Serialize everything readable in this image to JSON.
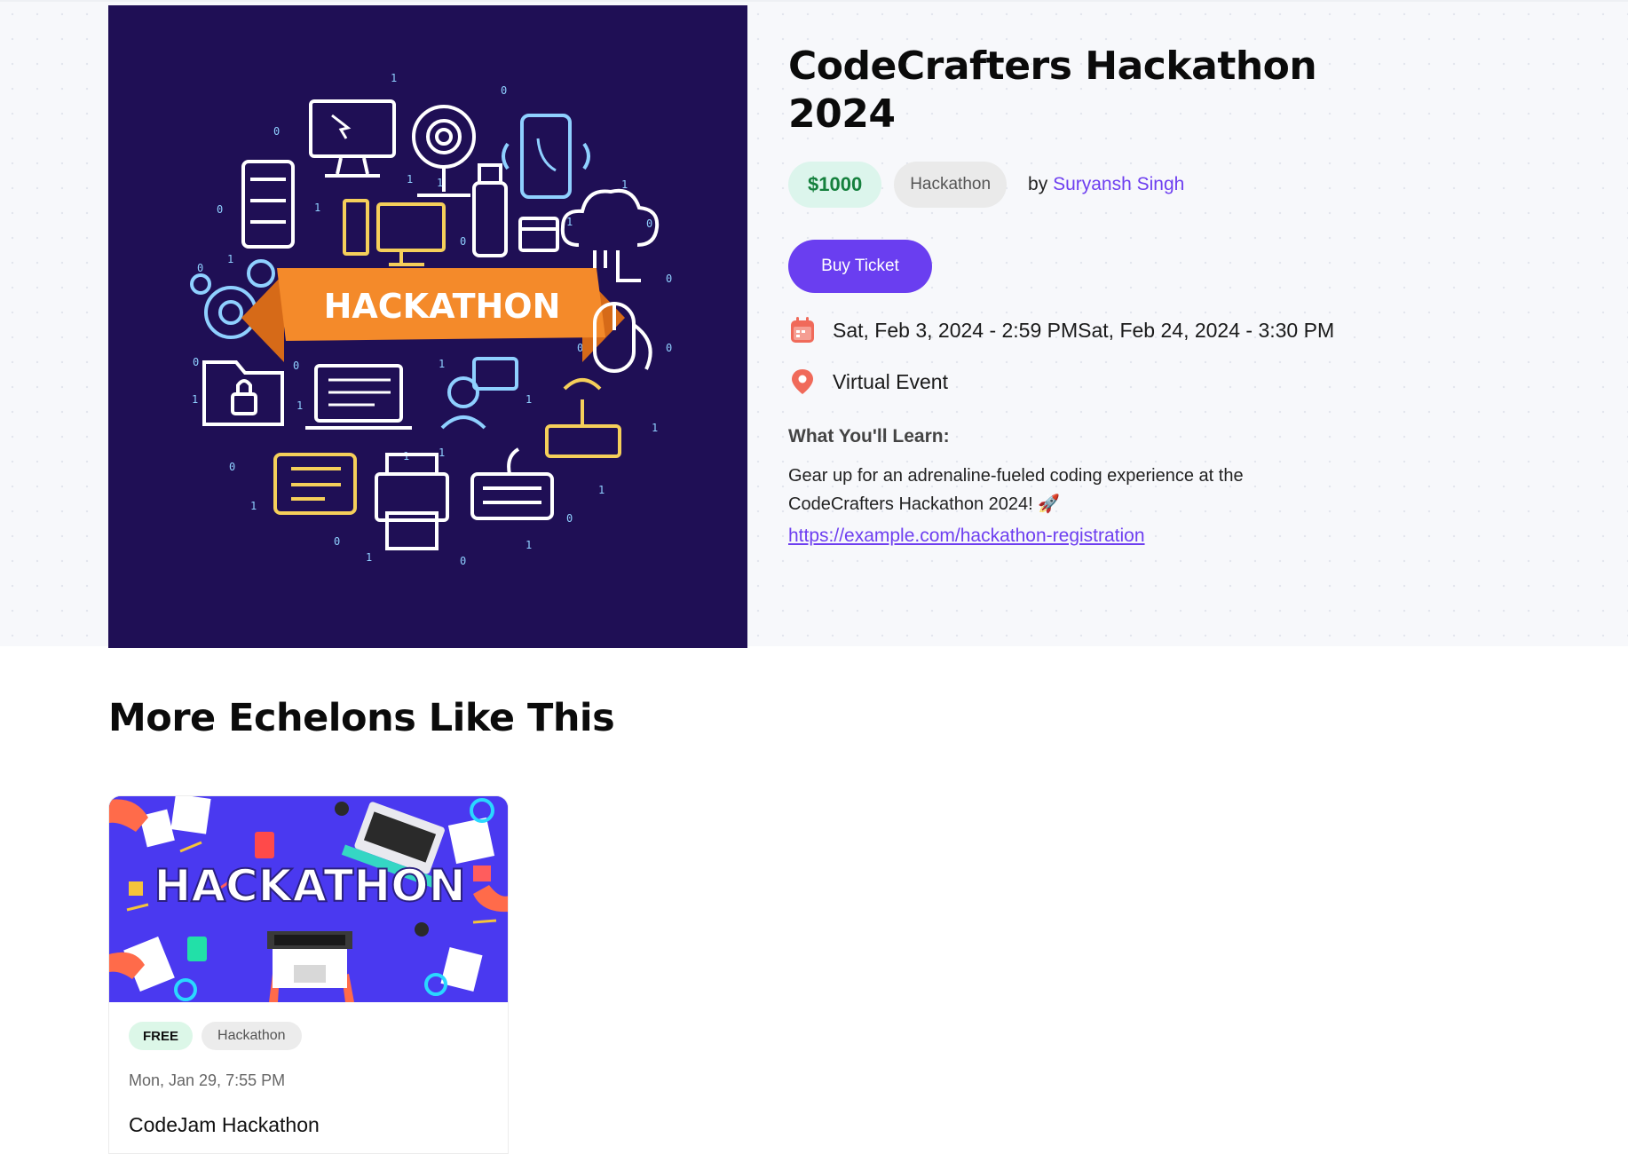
{
  "event": {
    "title": "CodeCrafters Hackathon 2024",
    "price": "$1000",
    "category": "Hackathon",
    "by_prefix": "by",
    "organizer": "Suryansh Singh",
    "buy_label": "Buy Ticket",
    "datetime": "Sat, Feb 3, 2024 - 2:59 PMSat, Feb 24, 2024 - 3:30 PM",
    "location": "Virtual Event",
    "learn_heading": "What You'll Learn:",
    "description": "Gear up for an adrenaline-fueled coding experience at the CodeCrafters Hackathon 2024! 🚀",
    "link": "https://example.com/hackathon-registration",
    "banner_text": "HACKATHON"
  },
  "related": {
    "heading": "More Echelons Like This",
    "cards": [
      {
        "price": "FREE",
        "category": "Hackathon",
        "date": "Mon, Jan 29, 7:55 PM",
        "title": "CodeJam Hackathon",
        "banner_text": "HACKATHON"
      }
    ]
  },
  "colors": {
    "accent": "#6a3ef0",
    "price_green": "#15803d",
    "hero_image_bg": "#1f0f55",
    "card_image_bg": "#4a39f0",
    "ribbon_orange": "#f48a2a"
  },
  "icons": [
    "calendar-icon",
    "location-pin-icon"
  ]
}
